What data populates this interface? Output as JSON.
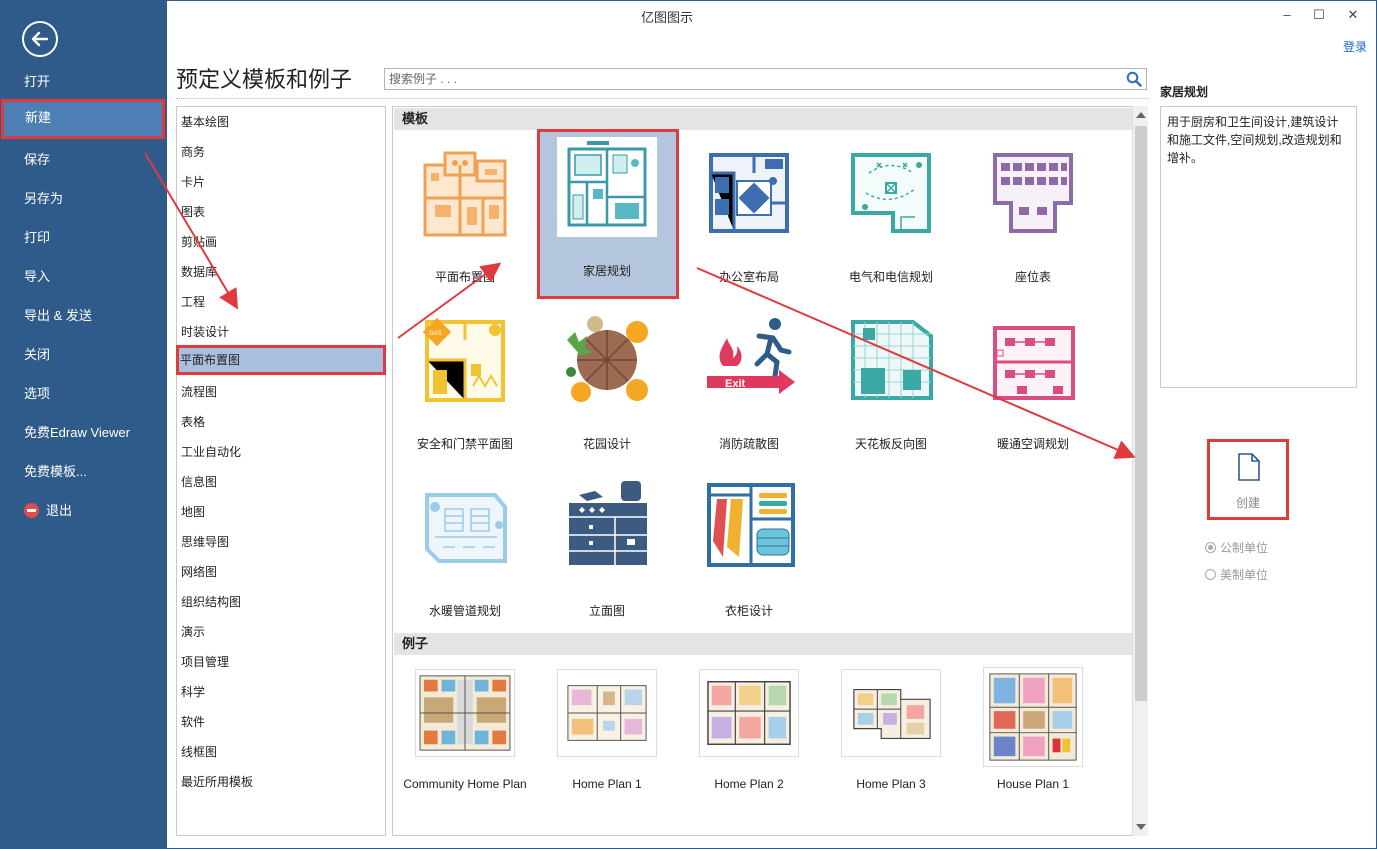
{
  "window": {
    "title": "亿图图示",
    "login_label": "登录",
    "minimize": "–",
    "maximize": "☐",
    "close": "✕"
  },
  "backstage": {
    "items": [
      {
        "label": "打开"
      },
      {
        "label": "新建"
      },
      {
        "label": "保存"
      },
      {
        "label": "另存为"
      },
      {
        "label": "打印"
      },
      {
        "label": "导入"
      },
      {
        "label": "导出 & 发送"
      },
      {
        "label": "关闭"
      },
      {
        "label": "选项"
      },
      {
        "label": "免费Edraw Viewer"
      },
      {
        "label": "免费模板..."
      },
      {
        "label": "退出"
      }
    ],
    "active": "新建"
  },
  "main": {
    "heading": "预定义模板和例子",
    "search_placeholder": "搜索例子 . . ."
  },
  "categories": [
    "基本绘图",
    "商务",
    "卡片",
    "图表",
    "剪贴画",
    "数据库",
    "工程",
    "时装设计",
    "平面布置图",
    "流程图",
    "表格",
    "工业自动化",
    "信息图",
    "地图",
    "思维导图",
    "网络图",
    "组织结构图",
    "演示",
    "项目管理",
    "科学",
    "软件",
    "线框图",
    "最近所用模板"
  ],
  "active_category": "平面布置图",
  "templates_header": "模板",
  "templates": [
    {
      "label": "平面布置图",
      "icon": "floor-plan-icon"
    },
    {
      "label": "家居规划",
      "icon": "home-plan-icon"
    },
    {
      "label": "办公室布局",
      "icon": "office-layout-icon"
    },
    {
      "label": "电气和电信规划",
      "icon": "electrical-plan-icon"
    },
    {
      "label": "座位表",
      "icon": "seating-chart-icon"
    },
    {
      "label": "安全和门禁平面图",
      "icon": "security-plan-icon"
    },
    {
      "label": "花园设计",
      "icon": "garden-design-icon"
    },
    {
      "label": "消防疏散图",
      "icon": "fire-exit-icon"
    },
    {
      "label": "天花板反向图",
      "icon": "ceiling-plan-icon"
    },
    {
      "label": "暖通空调规划",
      "icon": "hvac-plan-icon"
    },
    {
      "label": "水暖管道规划",
      "icon": "plumbing-plan-icon"
    },
    {
      "label": "立面图",
      "icon": "elevation-icon"
    },
    {
      "label": "衣柜设计",
      "icon": "wardrobe-icon"
    }
  ],
  "selected_template": "家居规划",
  "exit_sign_text": "Exit",
  "gas_label": "GAS",
  "examples_header": "例子",
  "examples": [
    {
      "label": "Community Home Plan"
    },
    {
      "label": "Home Plan 1"
    },
    {
      "label": "Home Plan 2"
    },
    {
      "label": "Home Plan 3"
    },
    {
      "label": "House Plan 1"
    }
  ],
  "details": {
    "title": "家居规划",
    "description": "用于厨房和卫生间设计,建筑设计和施工文件,空间规划,改造规划和增补。",
    "create_label": "创建",
    "units": [
      {
        "label": "公制单位",
        "checked": true
      },
      {
        "label": "美制单位",
        "checked": false
      }
    ]
  },
  "colors": {
    "sidebar": "#2f5b8a",
    "accent_red": "#e0393e",
    "selected_bg": "#b3c6dd",
    "link": "#1a66c7"
  }
}
